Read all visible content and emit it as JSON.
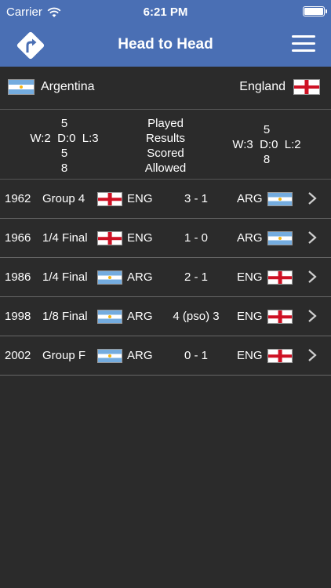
{
  "status_bar": {
    "carrier": "Carrier",
    "time": "6:21 PM",
    "battery_level": 1.0
  },
  "nav": {
    "title": "Head to Head",
    "back_icon": "back-arrow-sign-icon",
    "menu_icon": "hamburger-menu-icon"
  },
  "teams": {
    "left": {
      "name": "Argentina",
      "flag": "argentina-flag"
    },
    "right": {
      "name": "England",
      "flag": "england-flag"
    }
  },
  "summary": {
    "labels": [
      "Played",
      "Results",
      "Scored",
      "Allowed"
    ],
    "left": {
      "played": "5",
      "results": "W:2  D:0  L:3",
      "scored": "5",
      "allowed": "8"
    },
    "right": {
      "played": "5",
      "results": "W:3  D:0  L:2",
      "allowed": "8"
    }
  },
  "matches": [
    {
      "year": "1962",
      "round": "Group 4",
      "home": "ENG",
      "home_flag": "eng",
      "score": "3 - 1",
      "away": "ARG",
      "away_flag": "arg"
    },
    {
      "year": "1966",
      "round": "1/4 Final",
      "home": "ENG",
      "home_flag": "eng",
      "score": "1 - 0",
      "away": "ARG",
      "away_flag": "arg"
    },
    {
      "year": "1986",
      "round": "1/4 Final",
      "home": "ARG",
      "home_flag": "arg",
      "score": "2 - 1",
      "away": "ENG",
      "away_flag": "eng"
    },
    {
      "year": "1998",
      "round": "1/8 Final",
      "home": "ARG",
      "home_flag": "arg",
      "score": "4 (pso) 3",
      "away": "ENG",
      "away_flag": "eng"
    },
    {
      "year": "2002",
      "round": "Group F",
      "home": "ARG",
      "home_flag": "arg",
      "score": "0 - 1",
      "away": "ENG",
      "away_flag": "eng"
    }
  ],
  "colors": {
    "nav_bar": "#4a6fb4",
    "background": "#2b2b2b",
    "text": "#ffffff"
  }
}
